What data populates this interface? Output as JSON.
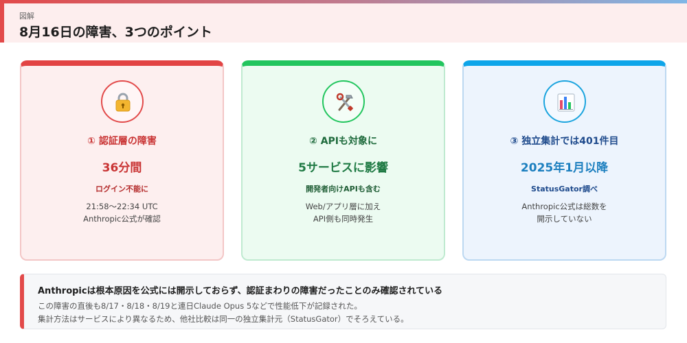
{
  "header": {
    "kicker": "図解",
    "title": "8月16日の障害、3つのポイント"
  },
  "colors": {
    "red": "#e24444",
    "green": "#22c55e",
    "blue": "#0ea5e9"
  },
  "cards": [
    {
      "icon": "lock-icon",
      "step": "① 認証層の障害",
      "big": "36分間",
      "sub": "ログイン不能に",
      "desc": [
        "21:58〜22:34 UTC",
        "Anthropic公式が確認"
      ]
    },
    {
      "icon": "tools-icon",
      "step": "② APIも対象に",
      "big": "5サービスに影響",
      "sub": "開発者向けAPIも含む",
      "desc": [
        "Web/アプリ層に加え",
        "API側も同時発生"
      ]
    },
    {
      "icon": "bar-chart-icon",
      "step": "③ 独立集計では401件目",
      "big": "2025年1月以降",
      "sub": "StatusGator調べ",
      "desc": [
        "Anthropic公式は総数を",
        "開示していない"
      ]
    }
  ],
  "note": {
    "title": "Anthropicは根本原因を公式には開示しておらず、認証まわりの障害だったことのみ確認されている",
    "lines": [
      "この障害の直後も8/17・8/18・8/19と連日Claude Opus 5などで性能低下が記録された。",
      "集計方法はサービスにより異なるため、他社比較は同一の独立集計元（StatusGator）でそろえている。"
    ]
  }
}
